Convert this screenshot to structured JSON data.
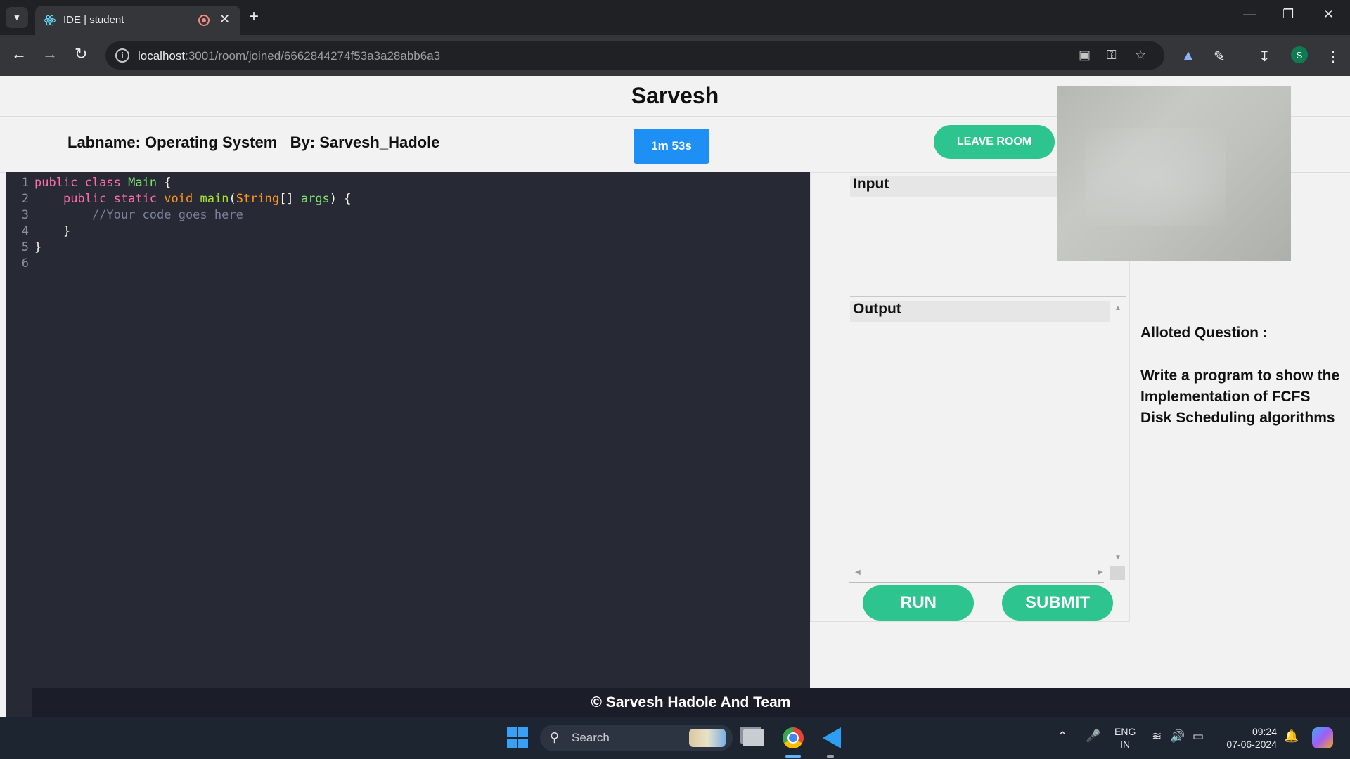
{
  "browser": {
    "tab_title": "IDE | student",
    "url_host": "localhost",
    "url_path": ":3001/room/joined/6662844274f53a3a28abb6a3",
    "profile_initial": "S",
    "icons": {
      "tab_menu": "chevron-down-icon",
      "back": "back-arrow-icon",
      "forward": "forward-arrow-icon",
      "reload": "reload-icon",
      "site_info": "info-icon",
      "camera": "camera-icon",
      "password": "key-icon",
      "bookmark": "star-icon",
      "extensions": "puzzle-icon",
      "downloads": "download-icon",
      "menu": "kebab-menu-icon"
    }
  },
  "page": {
    "title": "Sarvesh",
    "labname": "Labname: Operating System",
    "by": "By: Sarvesh_Hadole",
    "timer": "1m 53s",
    "leave_label": "LEAVE ROOM"
  },
  "editor": {
    "line_numbers": [
      "1",
      "2",
      "3",
      "4",
      "5",
      "6"
    ],
    "line1": {
      "kw1": "public",
      "kw2": "class",
      "cls": "Main",
      "rest": "{"
    },
    "line2": {
      "kw1": "public",
      "kw2": "static",
      "typ": "void",
      "fn": "main",
      "p1": "(",
      "typ2": "String",
      "p2": "[] ",
      "arg": "args",
      "rest": ") {"
    },
    "line3": {
      "comment": "//Your code goes here"
    },
    "line4": {
      "rest": "}"
    },
    "line5": {
      "rest": "}"
    }
  },
  "io": {
    "input_label": "Input",
    "output_label": "Output",
    "run_label": "RUN",
    "submit_label": "SUBMIT"
  },
  "question": {
    "heading": "Alloted Question :",
    "text": "Write a program to show the Implementation of FCFS Disk Scheduling algorithms"
  },
  "footer": {
    "text": "© Sarvesh Hadole And Team"
  },
  "taskbar": {
    "search_label": "Search",
    "lang_line1": "ENG",
    "lang_line2": "IN",
    "time": "09:24",
    "date": "07-06-2024"
  },
  "colors": {
    "accent_green": "#2ec48f",
    "timer_blue": "#1e8ff5",
    "editor_bg": "#272a35"
  }
}
